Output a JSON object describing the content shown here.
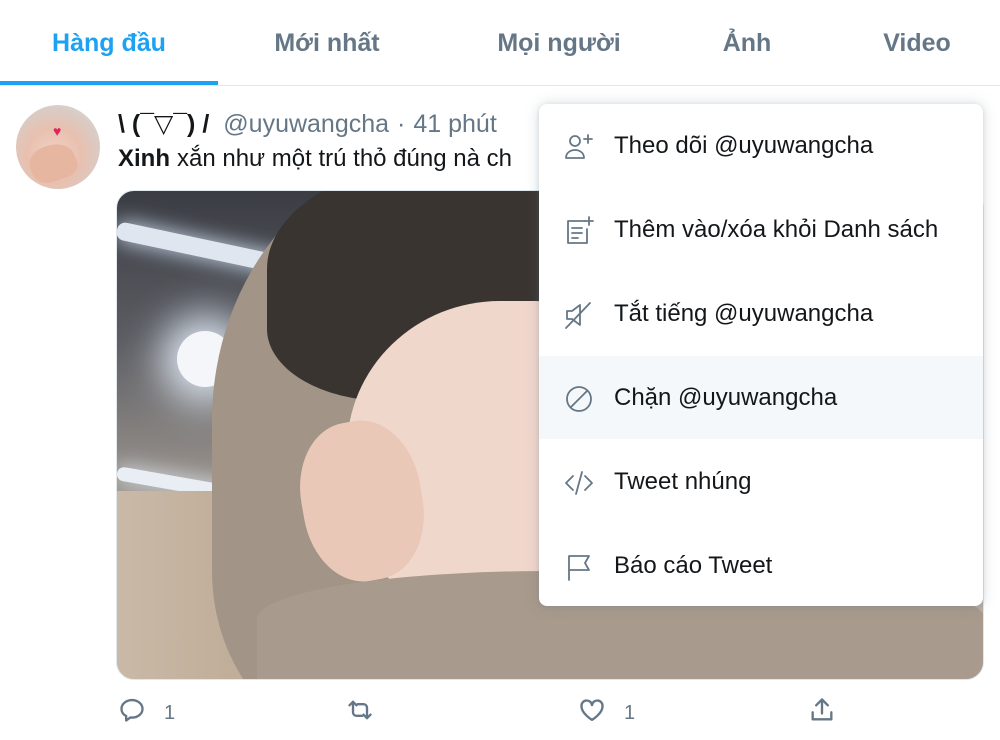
{
  "tabs": [
    {
      "label": "Hàng đầu",
      "active": true
    },
    {
      "label": "Mới nhất"
    },
    {
      "label": "Mọi người"
    },
    {
      "label": "Ảnh"
    },
    {
      "label": "Video"
    }
  ],
  "tweet": {
    "display_name": "\\ (¯▽¯) /",
    "handle": "@uyuwangcha",
    "separator": "·",
    "timestamp": "41 phút",
    "text_bold": "Xinh",
    "text_rest": "xắn như một trú thỏ đúng nà ch",
    "actions": {
      "reply_count": "1",
      "retweet_count": "",
      "like_count": "1"
    }
  },
  "menu": {
    "items": [
      {
        "label": "Theo dõi @uyuwangcha",
        "icon": "follow-user-icon"
      },
      {
        "label": "Thêm vào/xóa khỏi Danh sách",
        "icon": "add-to-list-icon"
      },
      {
        "label": "Tắt tiếng @uyuwangcha",
        "icon": "mute-icon"
      },
      {
        "label": "Chặn @uyuwangcha",
        "icon": "block-icon"
      },
      {
        "label": "Tweet nhúng",
        "icon": "embed-code-icon"
      },
      {
        "label": "Báo cáo Tweet",
        "icon": "report-flag-icon"
      }
    ]
  },
  "colors": {
    "accent": "#1da1f2",
    "secondary_text": "#657786",
    "primary_text": "#14171a",
    "hover_bg": "#f5f8fa"
  }
}
